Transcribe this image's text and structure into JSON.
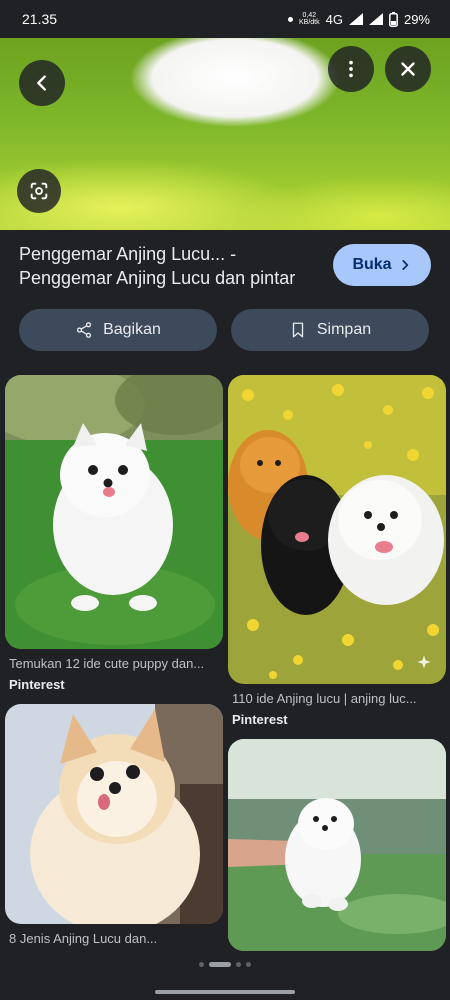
{
  "status": {
    "time": "21.35",
    "speed_value": "0,42",
    "speed_unit": "KB/dtk",
    "network": "4G",
    "battery": "29%"
  },
  "header": {
    "title": "Penggemar Anjing Lucu... - Penggemar Anjing Lucu dan pintar",
    "open_label": "Buka"
  },
  "actions": {
    "share_label": "Bagikan",
    "save_label": "Simpan"
  },
  "results": [
    {
      "caption": "Temukan 12 ide cute puppy dan...",
      "source": "Pinterest"
    },
    {
      "caption": "110 ide Anjing lucu | anjing luc...",
      "source": "Pinterest"
    },
    {
      "caption": "8 Jenis Anjing Lucu dan...",
      "source": ""
    },
    {
      "caption": "",
      "source": ""
    }
  ],
  "icons": {
    "back": "arrow-left-icon",
    "more": "more-vert-icon",
    "close": "close-icon",
    "lens": "lens-icon",
    "share": "share-icon",
    "save": "bookmark-icon",
    "open": "chevron-right-icon"
  },
  "colors": {
    "background": "#202124",
    "primary_button": "#a8c7fa",
    "secondary_button": "#3c4a5c"
  }
}
